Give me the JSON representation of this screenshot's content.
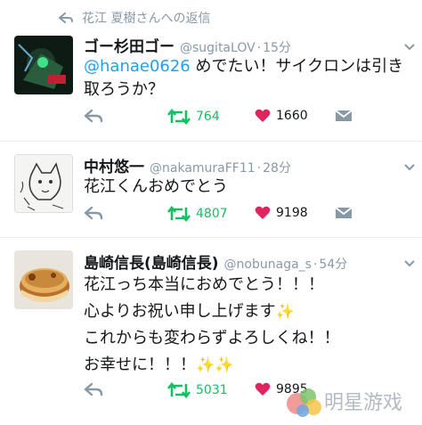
{
  "reply_context": {
    "text": "花江 夏樹さんへの返信",
    "icon": "reply-arrow-icon"
  },
  "tweets": [
    {
      "name": "ゴー杉田ゴー",
      "handle": "@sugitaLOV",
      "separator": "·",
      "time": "15分",
      "lines": [
        {
          "mention": "@hanae0626",
          "text": " めでたい！サイクロンは引き"
        },
        {
          "mention": "",
          "text": "取ろうか？"
        }
      ],
      "retweets": "764",
      "likes": "1660"
    },
    {
      "name": "中村悠一",
      "handle": "@nakamuraFF11",
      "separator": "·",
      "time": "28分",
      "lines": [
        {
          "mention": "",
          "text": "花江くんおめでとう"
        }
      ],
      "retweets": "4807",
      "likes": "9198"
    },
    {
      "name": "島崎信長(島崎信長)",
      "handle": "@nobunaga_s",
      "separator": "·",
      "time": "54分",
      "lines": [
        {
          "text": "花江っち本当におめでとう！！！",
          "sparkles": ""
        },
        {
          "text": "心よりお祝い申し上げます",
          "sparkles": "✨"
        },
        {
          "text": "これからも変わらずよろしくね！！",
          "sparkles": ""
        },
        {
          "text": "お幸せに！！！",
          "sparkles": "✨✨"
        }
      ],
      "retweets": "5031",
      "likes": "9895"
    }
  ],
  "watermark": {
    "text": "明星游戏"
  },
  "colors": {
    "retweet": "#17bf63",
    "like": "#e0245e",
    "mention": "#1da1f2",
    "muted": "#8899a6"
  }
}
